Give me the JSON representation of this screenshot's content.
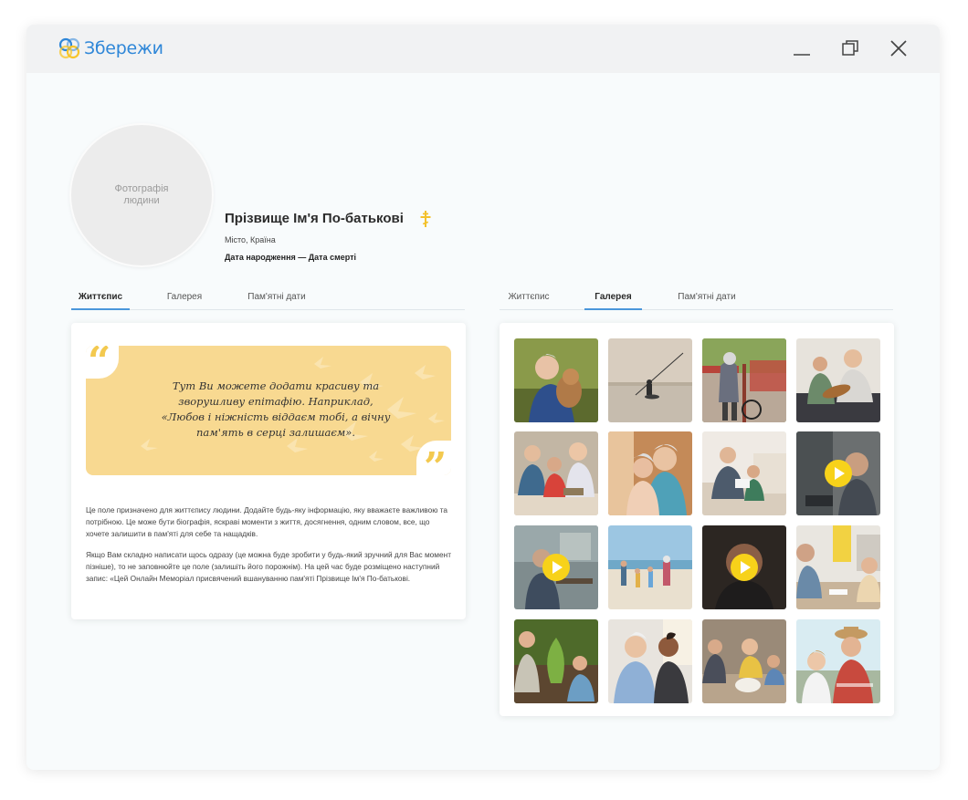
{
  "app": {
    "logo_text": "Збережи",
    "brand_blue": "#2f87d8",
    "brand_yellow": "#f7d21a"
  },
  "window_controls": [
    "minimize-icon",
    "restore-icon",
    "close-icon"
  ],
  "profile": {
    "photo_placeholder": "Фотографія\nлюдини",
    "name": "Прізвище Ім'я По-батькові",
    "religion_icon": "orthodox-cross-icon",
    "location": "Місто, Країна",
    "dates": "Дата народження — Дата смерті"
  },
  "tabs_left": {
    "items": [
      "Життєпис",
      "Галерея",
      "Пам'ятні дати"
    ],
    "active": "Життєпис"
  },
  "tabs_right": {
    "items": [
      "Життєпис",
      "Галерея",
      "Пам'ятні дати"
    ],
    "active": "Галерея"
  },
  "epitaph": {
    "text": "Тут Ви можете додати красиву та зворушливу епітафію. Наприклад, «Любов і ніжність віддаєм тобі, а вічну пам'ять в серці залишаєм»."
  },
  "biography": {
    "paragraphs": [
      "Це поле призначено для життєпису людини. Додайте будь-яку інформацію, яку вважаєте важливою та потрібною. Це може бути біографія, яскраві моменти з життя, досягнення, одним словом, все, що хочете залишити в пам'яті для себе та нащадків.",
      "Якщо Вам складно написати щось одразу (це можна буде зробити у будь-який зручний для Вас момент пізніше), то не заповнюйте це поле (залишіть його порожнім). На цей час буде розміщено наступний запис: «Цей Онлайн Меморіал присвячений вшануванню пам'яті Прізвище Ім'я По-батькові."
    ]
  },
  "gallery": {
    "items": [
      {
        "kind": "photo",
        "subject": "elderly man hugging dog"
      },
      {
        "kind": "photo",
        "subject": "boatman on river at sunset"
      },
      {
        "kind": "photo",
        "subject": "elderly man walking with bicycle"
      },
      {
        "kind": "photo",
        "subject": "grandfather playing guitar with boy"
      },
      {
        "kind": "photo",
        "subject": "grandparents with grandchildren"
      },
      {
        "kind": "photo",
        "subject": "elderly couple smiling"
      },
      {
        "kind": "photo",
        "subject": "grandfather reading with child"
      },
      {
        "kind": "video",
        "subject": "elderly man video"
      },
      {
        "kind": "video",
        "subject": "elderly man at desk video"
      },
      {
        "kind": "photo",
        "subject": "family walking on beach"
      },
      {
        "kind": "video",
        "subject": "elderly man portrait video"
      },
      {
        "kind": "photo",
        "subject": "grandfather and child playing cards"
      },
      {
        "kind": "photo",
        "subject": "grandfather gardening with boy"
      },
      {
        "kind": "photo",
        "subject": "elderly man laughing with son"
      },
      {
        "kind": "photo",
        "subject": "grandparents playing with kids and dog"
      },
      {
        "kind": "photo",
        "subject": "grandfather in hat with grandson"
      }
    ]
  }
}
